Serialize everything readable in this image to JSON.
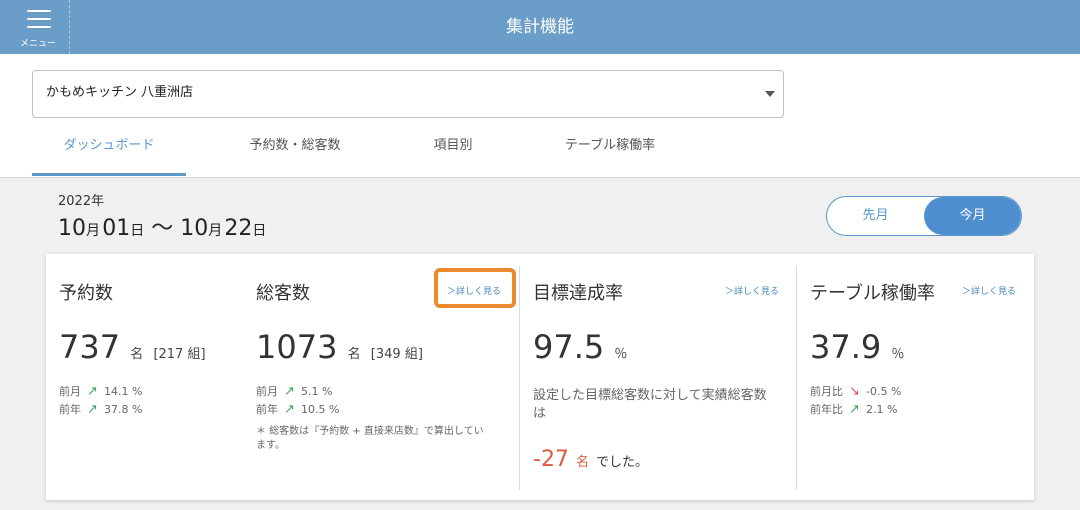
{
  "header": {
    "menu_label": "メニュー",
    "title": "集計機能"
  },
  "store": {
    "selected": "かもめキッチン 八重洲店"
  },
  "tabs": [
    "ダッシュボード",
    "予約数・総客数",
    "項目別",
    "テーブル稼働率"
  ],
  "period": {
    "year": "2022年",
    "start_month": "10",
    "start_day": "01",
    "end_month": "10",
    "end_day": "22",
    "month_unit": "月",
    "day_unit": "日",
    "separator": "〜"
  },
  "period_toggle": {
    "prev": "先月",
    "current": "今月"
  },
  "metrics": {
    "reservations": {
      "title": "予約数",
      "value": "737",
      "unit": "名",
      "groups": "[217 組]",
      "rows": [
        {
          "label": "前月",
          "trend": "up",
          "value": "14.1 %"
        },
        {
          "label": "前年",
          "trend": "up",
          "value": "37.8 %"
        }
      ]
    },
    "customers": {
      "title": "総客数",
      "link": "＞詳しく見る",
      "value": "1073",
      "unit": "名",
      "groups": "[349 組]",
      "rows": [
        {
          "label": "前月",
          "trend": "up",
          "value": "5.1 %"
        },
        {
          "label": "前年",
          "trend": "up",
          "value": "10.5 %"
        }
      ],
      "note_line1": "＊ 総客数は『予約数 + 直接来店数』で算出してい",
      "note_line2": "ます。"
    },
    "target": {
      "title": "目標達成率",
      "link": "＞詳しく見る",
      "value": "97.5",
      "unit": "％",
      "desc_line1": "設定した目標総客数に対して実績総客数",
      "desc_line2": "は",
      "diff_value": "-27",
      "diff_unit": "名",
      "diff_tail": "でした。"
    },
    "table_rate": {
      "title": "テーブル稼働率",
      "link": "＞詳しく見る",
      "value": "37.9",
      "unit": "％",
      "rows": [
        {
          "label": "前月比",
          "trend": "down",
          "value": "-0.5 %"
        },
        {
          "label": "前年比",
          "trend": "up",
          "value": "2.1 %"
        }
      ]
    }
  },
  "colors": {
    "header": "#6a9ec8",
    "accent": "#5b97c8",
    "up": "#3aaa55",
    "down": "#e05050",
    "highlight": "#ee8a2e",
    "negative": "#e05a3c"
  }
}
